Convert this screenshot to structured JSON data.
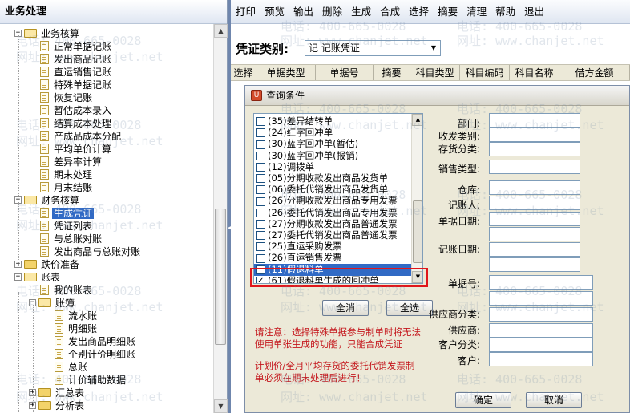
{
  "left_panel": {
    "title": "业务处理",
    "tree": [
      {
        "label": "业务核算",
        "type": "folder-open",
        "expander": "−",
        "selected": false
      },
      {
        "label": "正常单据记账",
        "type": "doc",
        "selected": false
      },
      {
        "label": "发出商品记账",
        "type": "doc",
        "selected": false
      },
      {
        "label": "直运销售记账",
        "type": "doc",
        "selected": false
      },
      {
        "label": "特殊单据记账",
        "type": "doc",
        "selected": false
      },
      {
        "label": "恢复记账",
        "type": "doc",
        "selected": false
      },
      {
        "label": "暂估成本录入",
        "type": "doc",
        "selected": false
      },
      {
        "label": "结算成本处理",
        "type": "doc",
        "selected": false
      },
      {
        "label": "产成品成本分配",
        "type": "doc",
        "selected": false
      },
      {
        "label": "平均单价计算",
        "type": "doc",
        "selected": false
      },
      {
        "label": "差异率计算",
        "type": "doc",
        "selected": false
      },
      {
        "label": "期末处理",
        "type": "doc",
        "selected": false
      },
      {
        "label": "月末结账",
        "type": "doc",
        "selected": false
      },
      {
        "label": "财务核算",
        "type": "folder-open",
        "expander": "−",
        "selected": false
      },
      {
        "label": "生成凭证",
        "type": "doc",
        "selected": true
      },
      {
        "label": "凭证列表",
        "type": "doc",
        "selected": false
      },
      {
        "label": "与总账对账",
        "type": "doc",
        "selected": false
      },
      {
        "label": "发出商品与总账对账",
        "type": "doc",
        "selected": false
      },
      {
        "label": "跌价准备",
        "type": "folder",
        "expander": "+",
        "selected": false
      },
      {
        "label": "账表",
        "type": "folder-open",
        "expander": "−",
        "selected": false
      },
      {
        "label": "我的账表",
        "type": "doc",
        "selected": false
      },
      {
        "label": "账簿",
        "type": "folder-open",
        "expander": "−",
        "selected": false
      },
      {
        "label": "流水账",
        "type": "doc",
        "selected": false
      },
      {
        "label": "明细账",
        "type": "doc",
        "selected": false
      },
      {
        "label": "发出商品明细账",
        "type": "doc",
        "selected": false
      },
      {
        "label": "个别计价明细账",
        "type": "doc",
        "selected": false
      },
      {
        "label": "总账",
        "type": "doc",
        "selected": false
      },
      {
        "label": "计价辅助数据",
        "type": "doc",
        "selected": false
      },
      {
        "label": "汇总表",
        "type": "folder",
        "expander": "+",
        "selected": false
      },
      {
        "label": "分析表",
        "type": "folder",
        "expander": "+",
        "selected": false
      }
    ]
  },
  "menubar": [
    "打印",
    "预览",
    "输出",
    "删除",
    "生成",
    "合成",
    "选择",
    "摘要",
    "清理",
    "帮助",
    "退出"
  ],
  "voucher_type": {
    "label": "凭证类别:",
    "value": "记 记账凭证"
  },
  "grid_columns": [
    "选择",
    "单据类型",
    "单据号",
    "摘要",
    "科目类型",
    "科目编码",
    "科目名称",
    "借方金额"
  ],
  "dialog": {
    "title": "查询条件",
    "list_items": [
      {
        "text": "(35)差异结转单",
        "checked": false,
        "selected": false
      },
      {
        "text": "(24)红字回冲单",
        "checked": false,
        "selected": false
      },
      {
        "text": "(30)蓝字回冲单(暂估)",
        "checked": false,
        "selected": false
      },
      {
        "text": "(30)蓝字回冲单(报销)",
        "checked": false,
        "selected": false
      },
      {
        "text": "(12)调拨单",
        "checked": false,
        "selected": false
      },
      {
        "text": "(05)分期收款发出商品发货单",
        "checked": false,
        "selected": false
      },
      {
        "text": "(06)委托代销发出商品发货单",
        "checked": false,
        "selected": false
      },
      {
        "text": "(26)分期收款发出商品专用发票",
        "checked": false,
        "selected": false
      },
      {
        "text": "(26)委托代销发出商品专用发票",
        "checked": false,
        "selected": false
      },
      {
        "text": "(27)分期收款发出商品普通发票",
        "checked": false,
        "selected": false
      },
      {
        "text": "(27)委托代销发出商品普通发票",
        "checked": false,
        "selected": false
      },
      {
        "text": "(25)直运采购发票",
        "checked": false,
        "selected": false
      },
      {
        "text": "(26)直运销售发票",
        "checked": false,
        "selected": false
      },
      {
        "text": "(11)假退料单",
        "checked": false,
        "selected": true
      },
      {
        "text": "(61)假退料单生成的回冲单",
        "checked": true,
        "selected": false
      }
    ],
    "btn_clear": "全消",
    "btn_select_all": "全选",
    "notice_1": "请注意：选择特殊单据参与制单时将无法使用单张生成的功能，只能合成凭证",
    "notice_2": "计划价/全月平均存货的委托代销发票制单必须在期末处理后进行！",
    "fields": {
      "dept": "部门:",
      "io_type": "收发类别:",
      "inv_class": "存货分类:",
      "sale_type": "销售类型:",
      "warehouse": "仓库:",
      "bookkeeper": "记账人:",
      "doc_date": "单据日期:",
      "post_date": "记账日期:",
      "doc_no": "单据号:",
      "supplier_class": "供应商分类:",
      "supplier": "供应商:",
      "customer_class": "客户分类:",
      "customer": "客户:"
    },
    "btn_ok": "确定",
    "btn_cancel": "取消"
  },
  "watermark": {
    "phone": "电话: 400-665-0028",
    "site": "网址: www.chanjet.net"
  }
}
